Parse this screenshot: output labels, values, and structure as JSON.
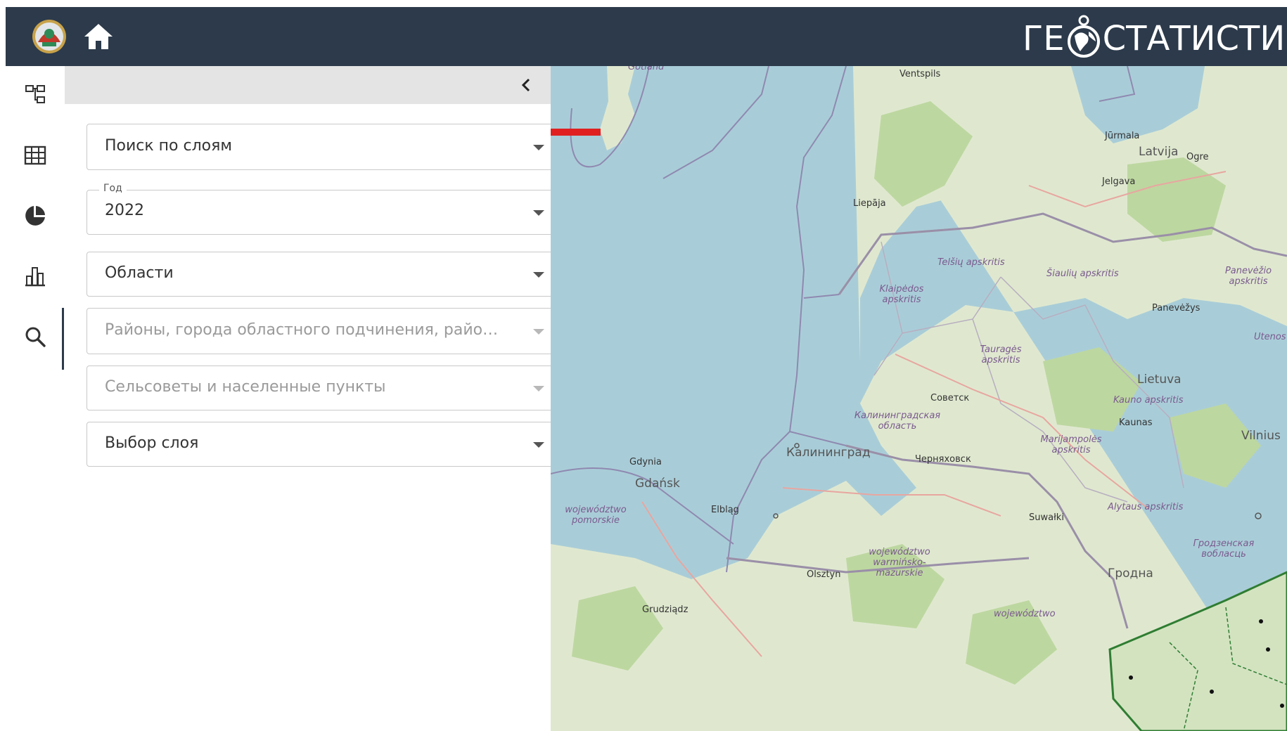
{
  "header": {
    "brand_prefix": "ГЕ",
    "brand_suffix": "СТАТИСТИК",
    "logo_icon": "emblem-logo-icon",
    "home_icon": "home-icon",
    "colors": {
      "bar": "#2c3a4b",
      "text": "#ffffff"
    }
  },
  "rail": {
    "items": [
      {
        "name": "layer-tree-icon"
      },
      {
        "name": "table-icon"
      },
      {
        "name": "pie-chart-icon"
      },
      {
        "name": "bar-chart-icon"
      },
      {
        "name": "search-icon",
        "active": true
      }
    ]
  },
  "panel": {
    "collapse_icon": "chevron-left-icon",
    "fields": {
      "layer_search": {
        "value": "Поиск по слоям"
      },
      "year": {
        "legend": "Год",
        "value": "2022"
      },
      "regions": {
        "value": "Области"
      },
      "districts": {
        "placeholder": "Районы, города областного подчинения, районные..."
      },
      "villages": {
        "placeholder": "Сельсоветы и населенные пункты"
      },
      "layer_select": {
        "value": "Выбор слоя"
      }
    },
    "annotation_color": "#e02020"
  },
  "map": {
    "colors": {
      "water": "#a9cdd8",
      "land": "#dfe8cf",
      "forest": "#bdd7a0",
      "border": "#9a8fa8",
      "belarus": "#2f7d32"
    },
    "labels": {
      "gotland": "Gotland",
      "ventspils": "Ventspils",
      "jurmala": "Jūrmala",
      "latvija": "Latvija",
      "ogre": "Ogre",
      "jelgava": "Jelgava",
      "liepaja": "Liepāja",
      "telsiu": "Telšių apskritis",
      "siauliu": "Šiaulių apskritis",
      "panevezio": "Panevėžio apskritis",
      "klaipedos": "Klaipėdos apskritis",
      "panevezys": "Panevėžys",
      "utenos": "Utenos",
      "taurages": "Tauragės apskritis",
      "lietuva": "Lietuva",
      "sovetsk": "Советск",
      "kauno": "Kauno apskritis",
      "kaliningrad_obl": "Калининградская область",
      "kaunas": "Kaunas",
      "vilnius": "Vilnius",
      "marijampoles": "Marijampolės apskritis",
      "kaliningrad": "Калининград",
      "chernyakhovsk": "Черняховск",
      "gdynia": "Gdynia",
      "gdansk": "Gdańsk",
      "elblag": "Elbląg",
      "pomorskie": "województwo pomorskie",
      "alytaus": "Alytaus apskritis",
      "suwalki": "Suwałki",
      "grodno_obl": "Гродзенская вобласць",
      "grodno": "Гродна",
      "warminsko": "województwo warmińsko-mazurskie",
      "olsztyn": "Olsztyn",
      "grudziadz": "Grudziądz",
      "wojewodztwo": "województwo"
    }
  }
}
